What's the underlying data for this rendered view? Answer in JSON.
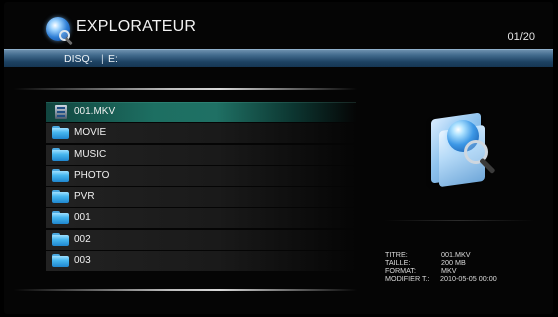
{
  "header": {
    "title": "EXPLORATEUR",
    "page_counter": "01/20",
    "icon": "explorer-globe-magnifier-icon"
  },
  "path_bar": {
    "drive_label": "DISQ.",
    "separator": "|",
    "drive_value": "E:"
  },
  "file_list": {
    "selected_index": 0,
    "items": [
      {
        "label": "001.MKV",
        "icon": "video-file-icon"
      },
      {
        "label": "MOVIE",
        "icon": "folder-icon"
      },
      {
        "label": "MUSIC",
        "icon": "folder-icon"
      },
      {
        "label": "PHOTO",
        "icon": "folder-icon"
      },
      {
        "label": "PVR",
        "icon": "folder-icon"
      },
      {
        "label": "001",
        "icon": "folder-icon"
      },
      {
        "label": "002",
        "icon": "folder-icon"
      },
      {
        "label": "003",
        "icon": "folder-icon"
      }
    ]
  },
  "preview": {
    "icon": "folder-globe-magnifier-icon"
  },
  "info": {
    "title_label": "TITRE:",
    "title_value": "001.MKV",
    "size_label": "TAILLE:",
    "size_value": "200 MB",
    "format_label": "FORMAT:",
    "format_value": "MKV",
    "modified_label": "MODIFIER T.:",
    "modified_value": "2010-05-05  00:00"
  },
  "colors": {
    "background": "#000000",
    "selection": "#1f7064",
    "path_bar": "#426b8d",
    "text": "#f0f0f0"
  }
}
